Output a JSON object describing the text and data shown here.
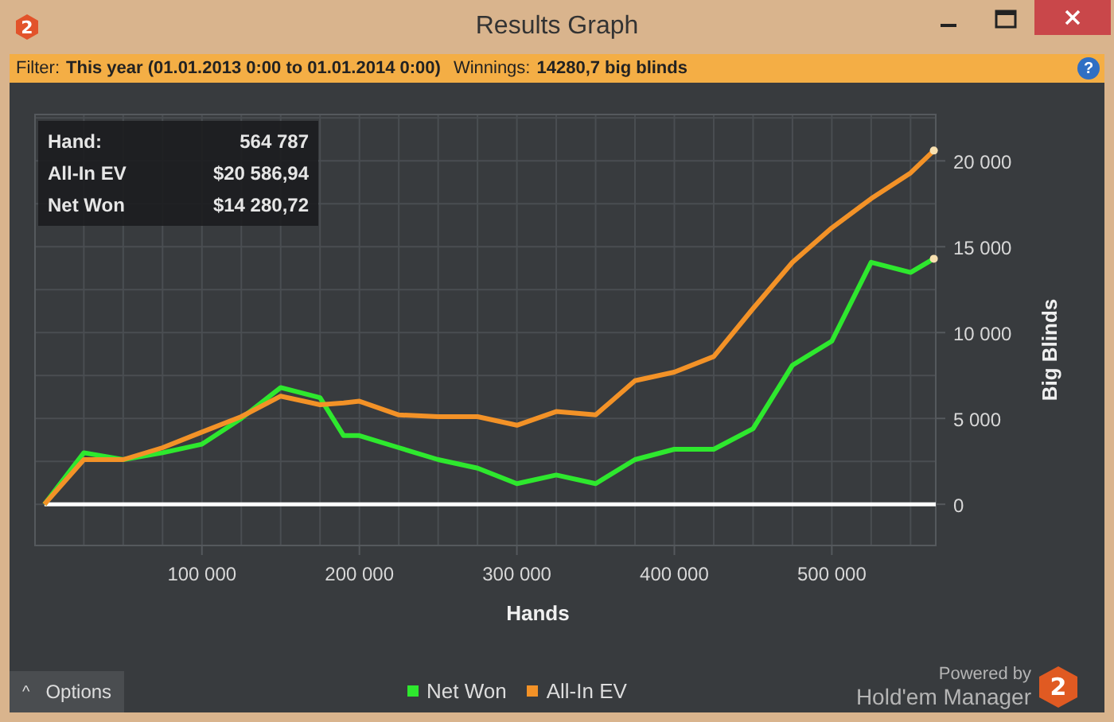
{
  "window": {
    "title": "Results Graph",
    "icon_text": "2"
  },
  "filter_bar": {
    "filter_label": "Filter:",
    "filter_value": "This year (01.01.2013 0:00 to 01.01.2014 0:00)",
    "winnings_label": "Winnings:",
    "winnings_value": "14280,7 big blinds",
    "help": "?"
  },
  "tooltip": {
    "rows": [
      {
        "label": "Hand:",
        "value": "564 787"
      },
      {
        "label": "All-In EV",
        "value": "$20 586,94"
      },
      {
        "label": "Net Won",
        "value": "$14 280,72"
      }
    ]
  },
  "chart_data": {
    "type": "line",
    "xlabel": "Hands",
    "ylabel": "Big Blinds",
    "x": [
      0,
      25000,
      50000,
      75000,
      100000,
      125000,
      150000,
      175000,
      190000,
      200000,
      225000,
      250000,
      275000,
      300000,
      325000,
      350000,
      375000,
      400000,
      425000,
      450000,
      475000,
      500000,
      525000,
      550000,
      564787
    ],
    "series": [
      {
        "name": "Net Won",
        "color": "#2ee82e",
        "values": [
          0,
          3000,
          2600,
          3000,
          3500,
          5000,
          6800,
          6200,
          4000,
          4000,
          3300,
          2600,
          2100,
          1200,
          1700,
          1200,
          2600,
          3200,
          3200,
          4400,
          8100,
          9500,
          14100,
          13500,
          14300
        ]
      },
      {
        "name": "All-In EV",
        "color": "#f39227",
        "values": [
          0,
          2600,
          2600,
          3300,
          4200,
          5100,
          6300,
          5800,
          5900,
          6000,
          5200,
          5100,
          5100,
          4600,
          5400,
          5200,
          7200,
          7700,
          8600,
          11400,
          14100,
          16100,
          17800,
          19300,
          20600
        ]
      }
    ],
    "grid": true,
    "xlim": [
      -6000,
      566000
    ],
    "ylim": [
      -2400,
      22700
    ],
    "xticks": [
      {
        "value": 100000,
        "label": "100 000"
      },
      {
        "value": 200000,
        "label": "200 000"
      },
      {
        "value": 300000,
        "label": "300 000"
      },
      {
        "value": 400000,
        "label": "400 000"
      },
      {
        "value": 500000,
        "label": "500 000"
      }
    ],
    "yticks": [
      {
        "value": 0,
        "label": "0"
      },
      {
        "value": 5000,
        "label": "5 000"
      },
      {
        "value": 10000,
        "label": "10 000"
      },
      {
        "value": 15000,
        "label": "15 000"
      },
      {
        "value": 20000,
        "label": "20 000"
      }
    ]
  },
  "options_button": {
    "label": "Options",
    "caret": "^"
  },
  "branding": {
    "powered_by": "Powered by",
    "product": "Hold'em Manager",
    "badge": "2"
  }
}
